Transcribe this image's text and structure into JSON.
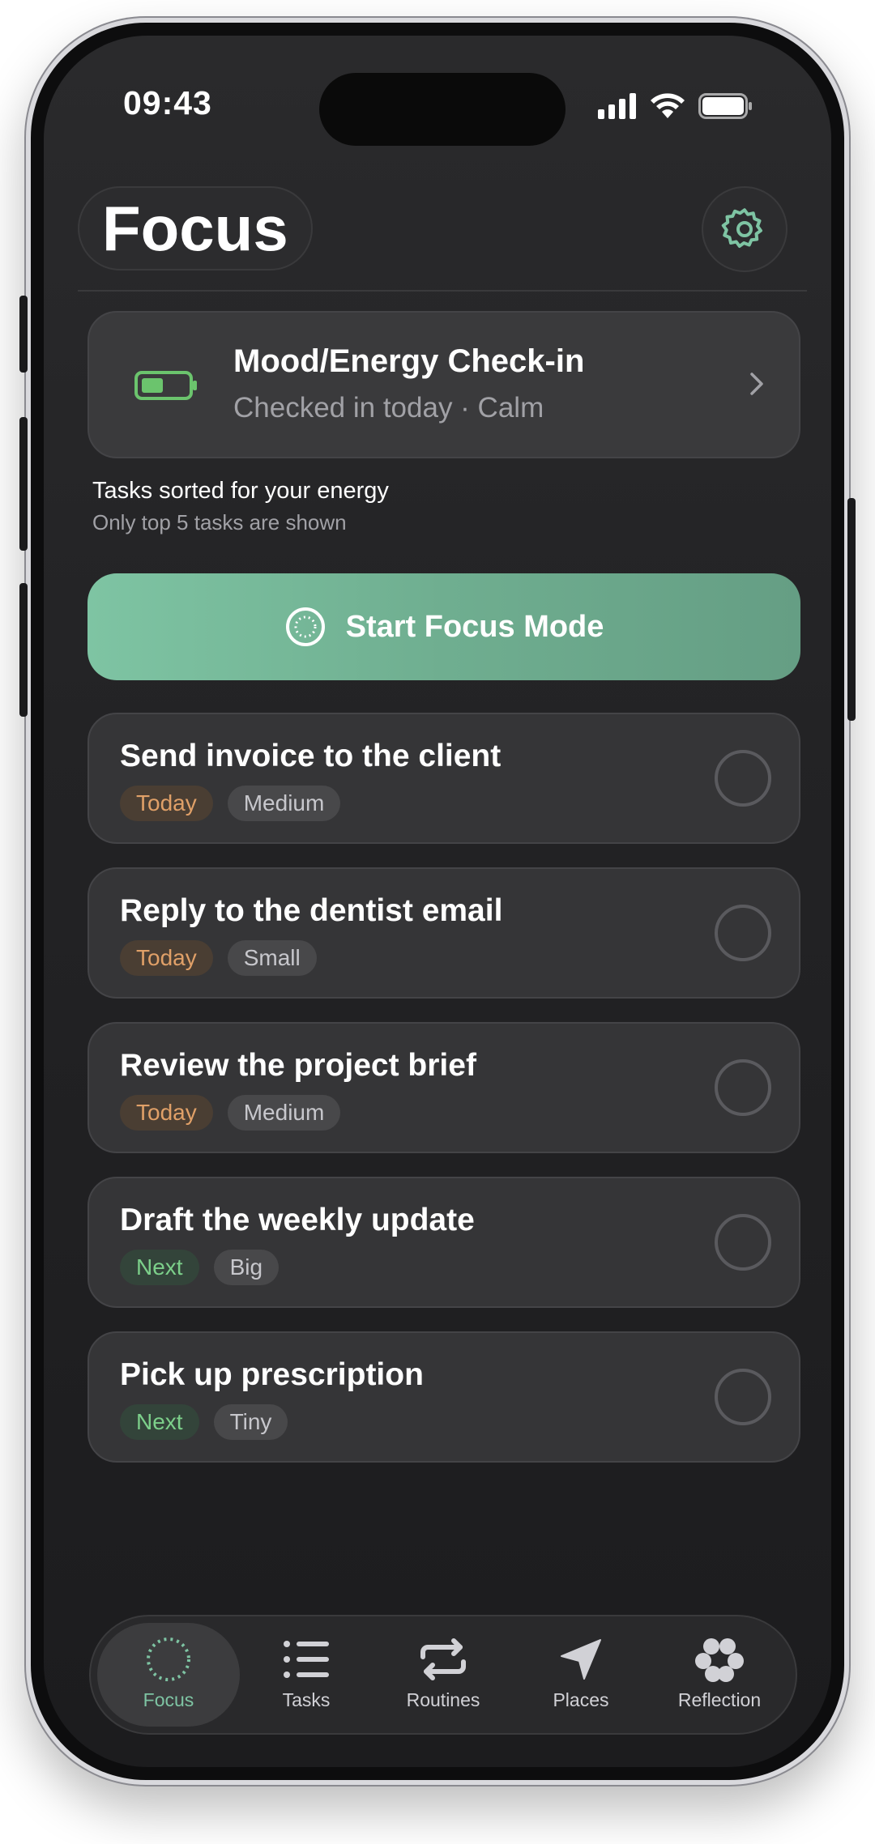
{
  "status_bar": {
    "time": "09:43"
  },
  "header": {
    "title": "Focus"
  },
  "mood_card": {
    "title": "Mood/Energy Check-in",
    "subtitle": "Checked in today · Calm",
    "color": "#6bc46d"
  },
  "info": {
    "line1": "Tasks sorted for your energy",
    "line2": "Only top 5 tasks are shown"
  },
  "focus_button": {
    "label": "Start Focus Mode"
  },
  "tasks": [
    {
      "title": "Send invoice to the client",
      "when": "Today",
      "size": "Medium"
    },
    {
      "title": "Reply to the dentist email",
      "when": "Today",
      "size": "Small"
    },
    {
      "title": "Review the project brief",
      "when": "Today",
      "size": "Medium"
    },
    {
      "title": "Draft the weekly update",
      "when": "Next",
      "size": "Big"
    },
    {
      "title": "Pick up prescription",
      "when": "Next",
      "size": "Tiny"
    }
  ],
  "tabs": [
    {
      "label": "Focus",
      "icon": "focus-circle-icon",
      "active": true
    },
    {
      "label": "Tasks",
      "icon": "list-icon"
    },
    {
      "label": "Routines",
      "icon": "repeat-icon"
    },
    {
      "label": "Places",
      "icon": "location-arrow-icon"
    },
    {
      "label": "Reflection",
      "icon": "flower-icon"
    }
  ],
  "colors": {
    "accent": "#7ec4a3",
    "today": "#e0a068",
    "next": "#7ccf8a"
  }
}
